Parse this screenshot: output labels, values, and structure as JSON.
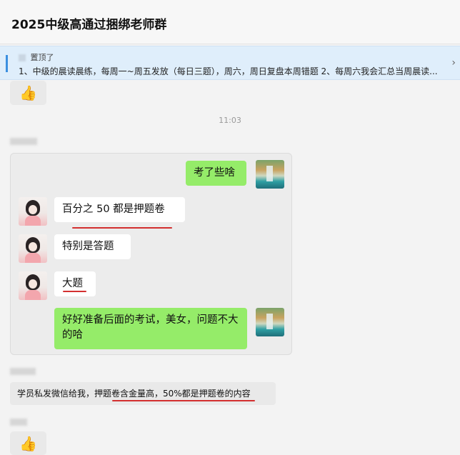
{
  "header": {
    "title": "2025中级高通过捆绑老师群"
  },
  "pinned": {
    "label": "置顶了",
    "text": "1、中级的晨读晨练，每周一~周五发放（每日三题），周六，周日复盘本周错题 2、每周六我会汇总当周晨读...",
    "close_icon": "chevron-right"
  },
  "reaction": {
    "icon": "thumbs-up-icon",
    "glyph": "👍"
  },
  "time": "11:03",
  "quote_card": {
    "messages": [
      {
        "side": "right",
        "text": "考了些啥"
      },
      {
        "side": "left",
        "text": "百分之 50 都是押题卷"
      },
      {
        "side": "left",
        "text": "特别是答题"
      },
      {
        "side": "left",
        "text": "大题"
      },
      {
        "side": "right",
        "text": "好好准备后面的考试，美女，问题不大的哈"
      }
    ]
  },
  "bottom_message": "学员私发微信给我，押题卷含金量高，50%都是押题卷的内容",
  "colors": {
    "green_bubble": "#95ec69",
    "underline": "#d32f2f",
    "pin_bg": "#dfeefb"
  }
}
